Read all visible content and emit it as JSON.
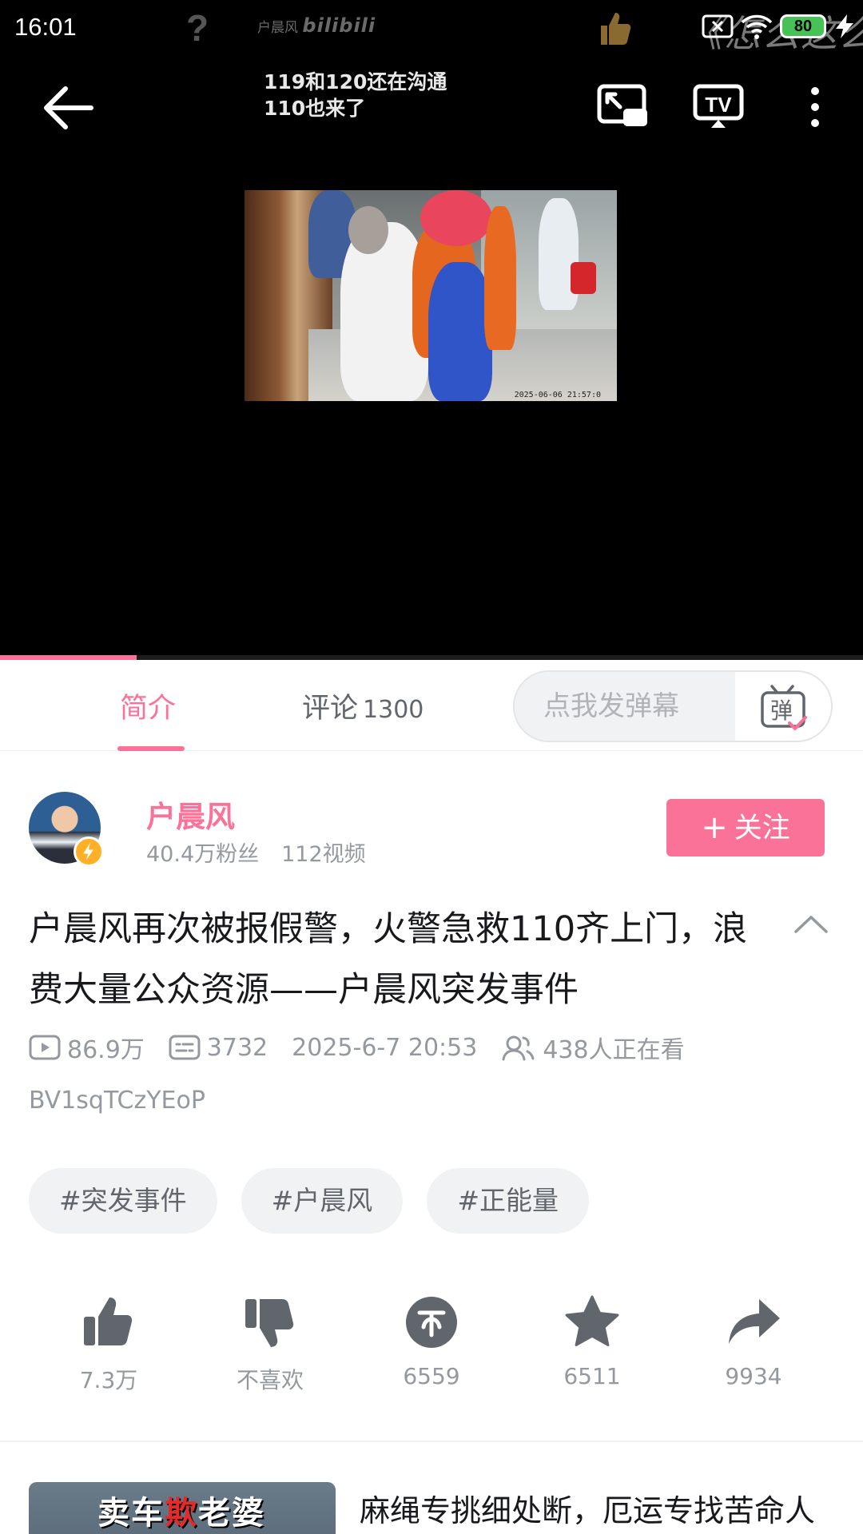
{
  "status_bar": {
    "time": "16:01",
    "question_mark": "?",
    "watermark_author": "户晨风",
    "watermark_brand": "bilibili",
    "side_text": "《怎么这么",
    "battery": "80"
  },
  "player": {
    "caption_line1": "119和120还在沟通",
    "caption_line2": "110也来了",
    "video_timestamp": "2025-06-06 21:57:0",
    "progress_fraction": 0.158
  },
  "tabs": {
    "intro_label": "简介",
    "comments_label": "评论",
    "comments_count": "1300",
    "danmaku_placeholder": "点我发弹幕",
    "danmaku_button_glyph": "弹"
  },
  "author": {
    "name": "户晨风",
    "fans": "40.4万粉丝",
    "videos": "112视频",
    "follow_label": "关注",
    "follow_plus": "+"
  },
  "video": {
    "title": "户晨风再次被报假警，火警急救110齐上门，浪费大量公众资源——户晨风突发事件",
    "views": "86.9万",
    "danmaku_count": "3732",
    "publish_time": "2025-6-7 20:53",
    "watching": "438人正在看",
    "bvid": "BV1sqTCzYEoP"
  },
  "tags": [
    "#突发事件",
    "#户晨风",
    "#正能量"
  ],
  "actions": {
    "like": "7.3万",
    "dislike": "不喜欢",
    "coin": "6559",
    "favorite": "6511",
    "share": "9934"
  },
  "recommended": {
    "thumb_text_a": "卖车",
    "thumb_text_b": "欺",
    "thumb_text_c": "老婆",
    "title": "麻绳专挑细处断，厄运专找苦命人"
  },
  "colors": {
    "accent_pink": "#fb7299",
    "text_primary": "#18191c",
    "text_secondary": "#61666d",
    "text_muted": "#9499a0",
    "icon_gray": "#61666d",
    "tag_bg": "#f1f2f3"
  }
}
